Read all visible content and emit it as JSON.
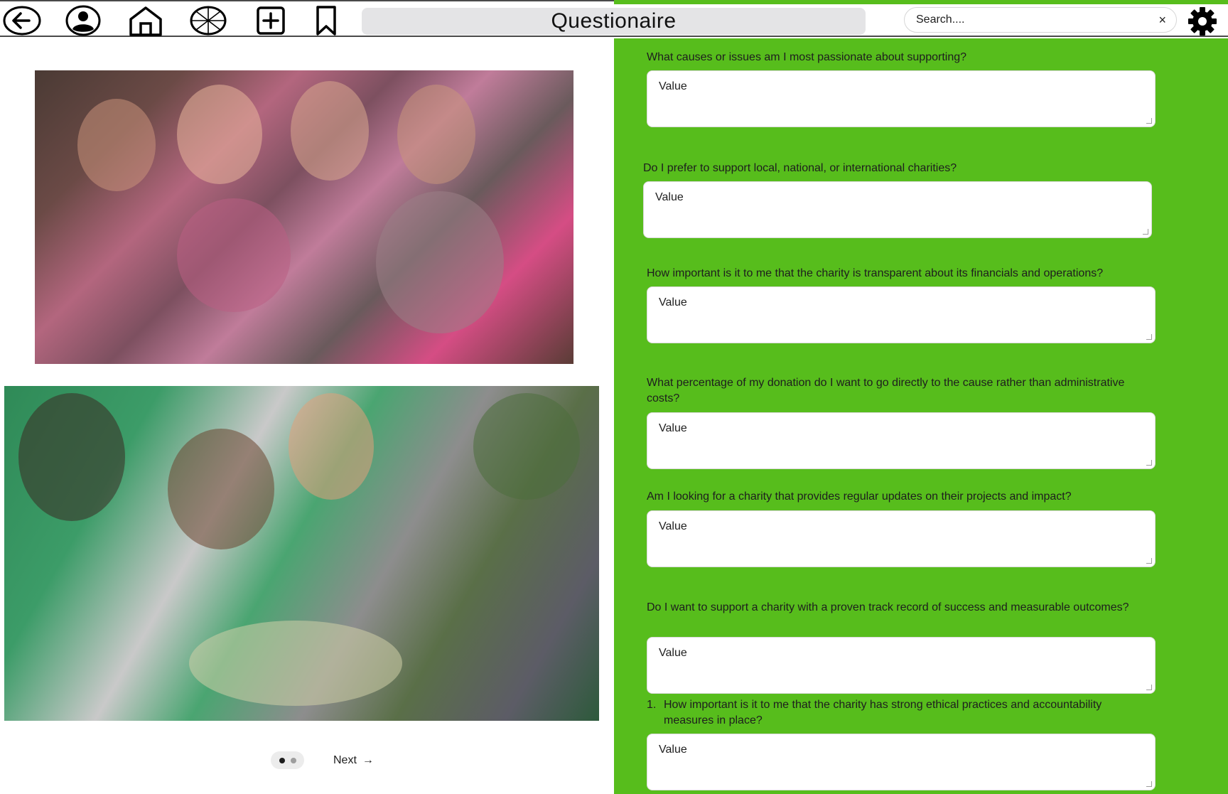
{
  "header": {
    "title": "Questionaire",
    "search": {
      "placeholder": "Search....",
      "clear_icon": "×"
    },
    "nav_icons": [
      "back-arrow-icon",
      "user-profile-icon",
      "home-icon",
      "wheel-icon",
      "add-square-icon",
      "bookmark-icon"
    ],
    "settings_icon": "gear-icon"
  },
  "left": {
    "images": [
      {
        "name": "children-photo",
        "description_icon": "photo"
      },
      {
        "name": "volunteers-photo",
        "description_icon": "photo"
      }
    ],
    "carousel": {
      "total": 2,
      "active_index": 0
    },
    "next_label": "Next",
    "next_icon": "→"
  },
  "questionnaire": {
    "questions": [
      {
        "label": "What causes or issues am I most passionate about supporting?",
        "value": "Value"
      },
      {
        "label": "Do I prefer to support local, national, or international charities?",
        "value": "Value"
      },
      {
        "label": "How important is it to me that the charity is transparent about its financials and operations?",
        "value": "Value"
      },
      {
        "label": "What percentage of my donation do I want to go directly to the cause rather than administrative costs?",
        "value": "Value"
      },
      {
        "label": "Am I looking for a charity that provides regular updates on their projects and impact?",
        "value": "Value"
      },
      {
        "label": "Do I want to support a charity with a proven track record of success and measurable outcomes?",
        "value": "Value"
      },
      {
        "number": "1.",
        "label": "How important is it to me that the charity has strong ethical practices and accountability measures in place?",
        "value": "Value"
      }
    ]
  },
  "colors": {
    "panel_green": "#57bd1c",
    "field_bg": "#ffffff",
    "title_pill": "#e4e4e6"
  }
}
